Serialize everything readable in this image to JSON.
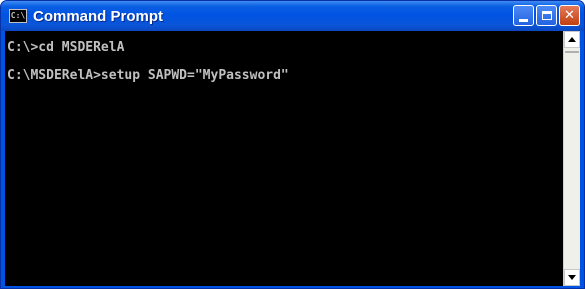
{
  "window": {
    "title": "Command Prompt",
    "icon_text": "C:\\"
  },
  "console": {
    "lines": [
      "C:\\>cd MSDERelA",
      "C:\\MSDERelA>setup SAPWD=\"MyPassword\""
    ]
  },
  "colors": {
    "titlebar": "#0054e3",
    "console_bg": "#000000",
    "console_fg": "#c0c0c0",
    "close_button": "#c2400f"
  },
  "icons": {
    "app": "cmd-icon",
    "minimize": "minimize-icon",
    "maximize": "maximize-icon",
    "close": "close-icon",
    "scroll_up": "arrow-up-icon",
    "scroll_down": "arrow-down-icon"
  }
}
